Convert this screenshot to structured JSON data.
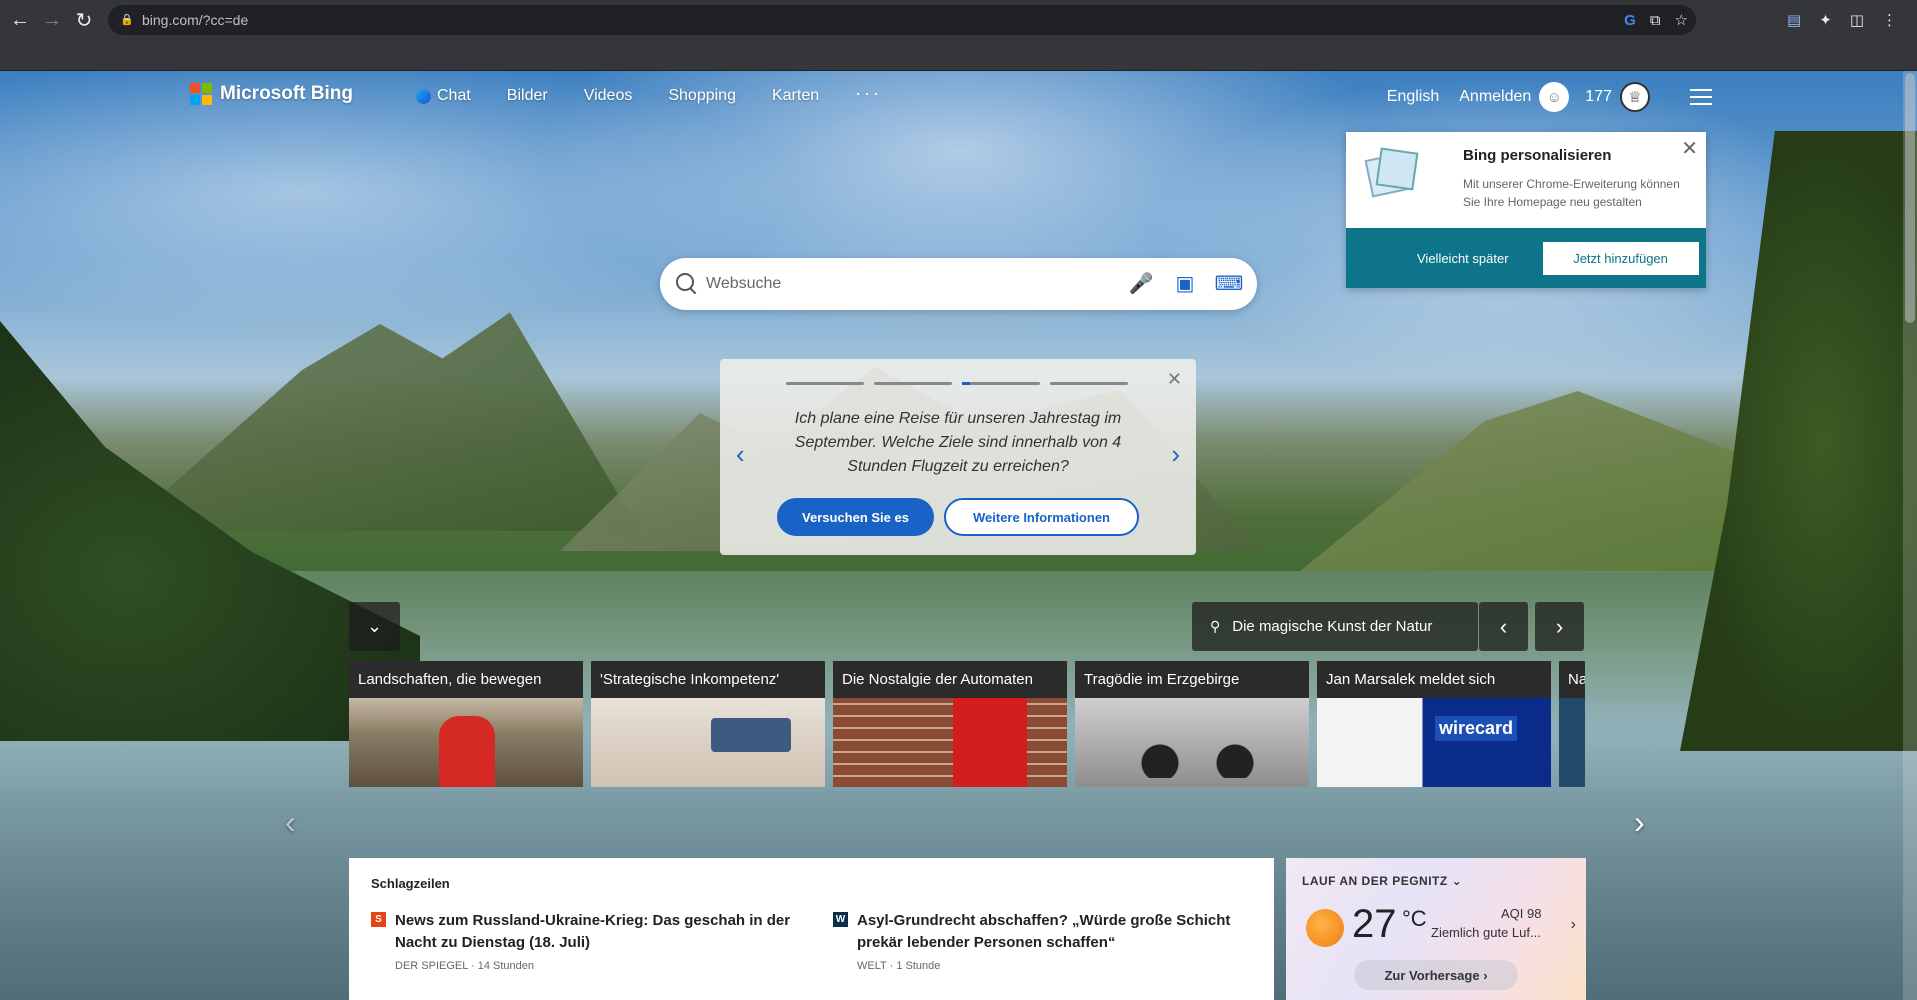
{
  "browser": {
    "url": "bing.com/?cc=de"
  },
  "header": {
    "logo_text": "Microsoft Bing",
    "nav": [
      "Chat",
      "Bilder",
      "Videos",
      "Shopping",
      "Karten"
    ],
    "more": "···",
    "language": "English",
    "signin": "Anmelden",
    "reward_points": "177"
  },
  "personalize": {
    "title": "Bing personalisieren",
    "text": "Mit unserer Chrome-Erweiterung können Sie Ihre Homepage neu gestalten",
    "later": "Vielleicht später",
    "add": "Jetzt hinzufügen"
  },
  "search": {
    "placeholder": "Websuche"
  },
  "prompt": {
    "text": "Ich plane eine Reise für unseren Jahrestag im September. Welche Ziele sind innerhalb von 4 Stunden Flugzeit zu erreichen?",
    "try_label": "Versuchen Sie es",
    "more_label": "Weitere Informationen",
    "active_step": 3,
    "total_steps": 4
  },
  "image_caption": "Die magische Kunst der Natur",
  "carousel": [
    {
      "title": "Landschaften, die bewegen"
    },
    {
      "title": "'Strategische Inkompetenz'"
    },
    {
      "title": "Die Nostalgie der Automaten"
    },
    {
      "title": "Tragödie im Erzgebirge"
    },
    {
      "title": "Jan Marsalek meldet sich"
    },
    {
      "title": "Na"
    }
  ],
  "headlines": {
    "title": "Schlagzeilen",
    "items": [
      {
        "logo": "S",
        "headline": "News zum Russland-Ukraine-Krieg: Das geschah in der Nacht zu Dienstag (18. Juli)",
        "source": "DER SPIEGEL · 14 Stunden"
      },
      {
        "logo": "W",
        "headline": "Asyl-Grundrecht abschaffen? „Würde große Schicht prekär lebender Personen schaffen“",
        "source": "WELT · 1 Stunde"
      }
    ]
  },
  "weather": {
    "location": "LAUF AN DER PEGNITZ",
    "temp": "27",
    "unit": "°C",
    "aqi": "AQI 98",
    "aqi_desc": "Ziemlich gute Luf...",
    "forecast": "Zur Vorhersage"
  },
  "colors": {
    "bing_blue": "#1a63c6",
    "teal": "#0e7489"
  }
}
